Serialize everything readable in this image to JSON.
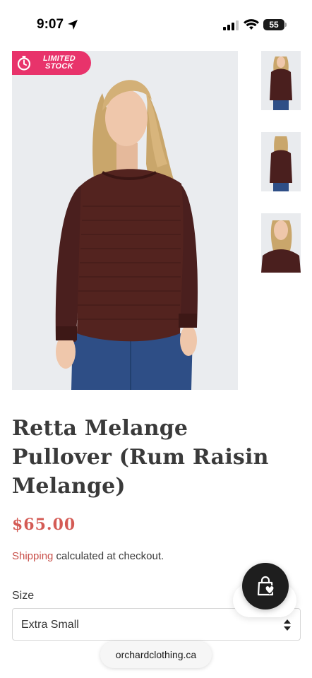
{
  "status_bar": {
    "time": "9:07",
    "battery": "55"
  },
  "product": {
    "badge_line1": "LIMITED",
    "badge_line2": "STOCK",
    "title": "Retta Melange Pullover (Rum Raisin Melange)",
    "price": "$65.00",
    "shipping_link": "Shipping",
    "shipping_text": " calculated at checkout.",
    "size_label": "Size",
    "size_selected": "Extra Small"
  },
  "thumbnails": [
    "front view",
    "back view",
    "detail view"
  ],
  "browser": {
    "url": "orchardclothing.ca"
  },
  "colors": {
    "badge": "#e8336b",
    "price": "#d45b55",
    "link": "#c9524c",
    "sweater": "#4a1f1e"
  },
  "icons": [
    "location-arrow-icon",
    "signal-icon",
    "wifi-icon",
    "battery-icon",
    "stopwatch-icon",
    "shopping-bag-heart-icon",
    "select-arrows-icon"
  ]
}
